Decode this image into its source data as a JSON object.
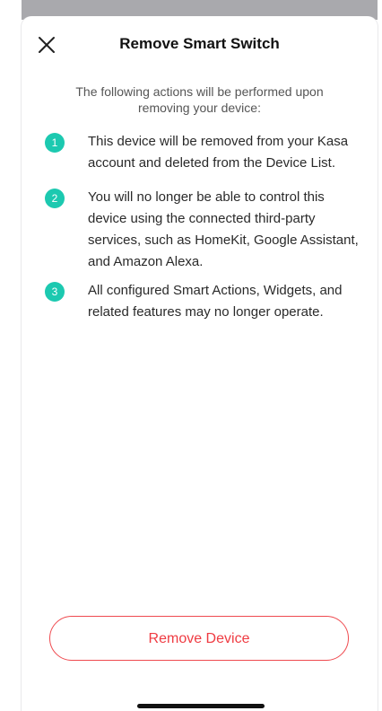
{
  "header": {
    "title": "Remove Smart Switch",
    "close_icon": "close-icon"
  },
  "intro": "The following actions will be performed upon removing your device:",
  "steps": [
    {
      "number": "1",
      "text": "This device will be removed from your Kasa account and deleted from the Device List."
    },
    {
      "number": "2",
      "text": "You will no longer be able to control this device using the connected third-party services, such as HomeKit, Google Assistant, and Amazon Alexa."
    },
    {
      "number": "3",
      "text": "All configured Smart Actions, Widgets, and related features may no longer operate."
    }
  ],
  "actions": {
    "remove_label": "Remove Device"
  },
  "colors": {
    "accent_teal": "#1cc9b0",
    "danger_red": "#ef3b42"
  }
}
